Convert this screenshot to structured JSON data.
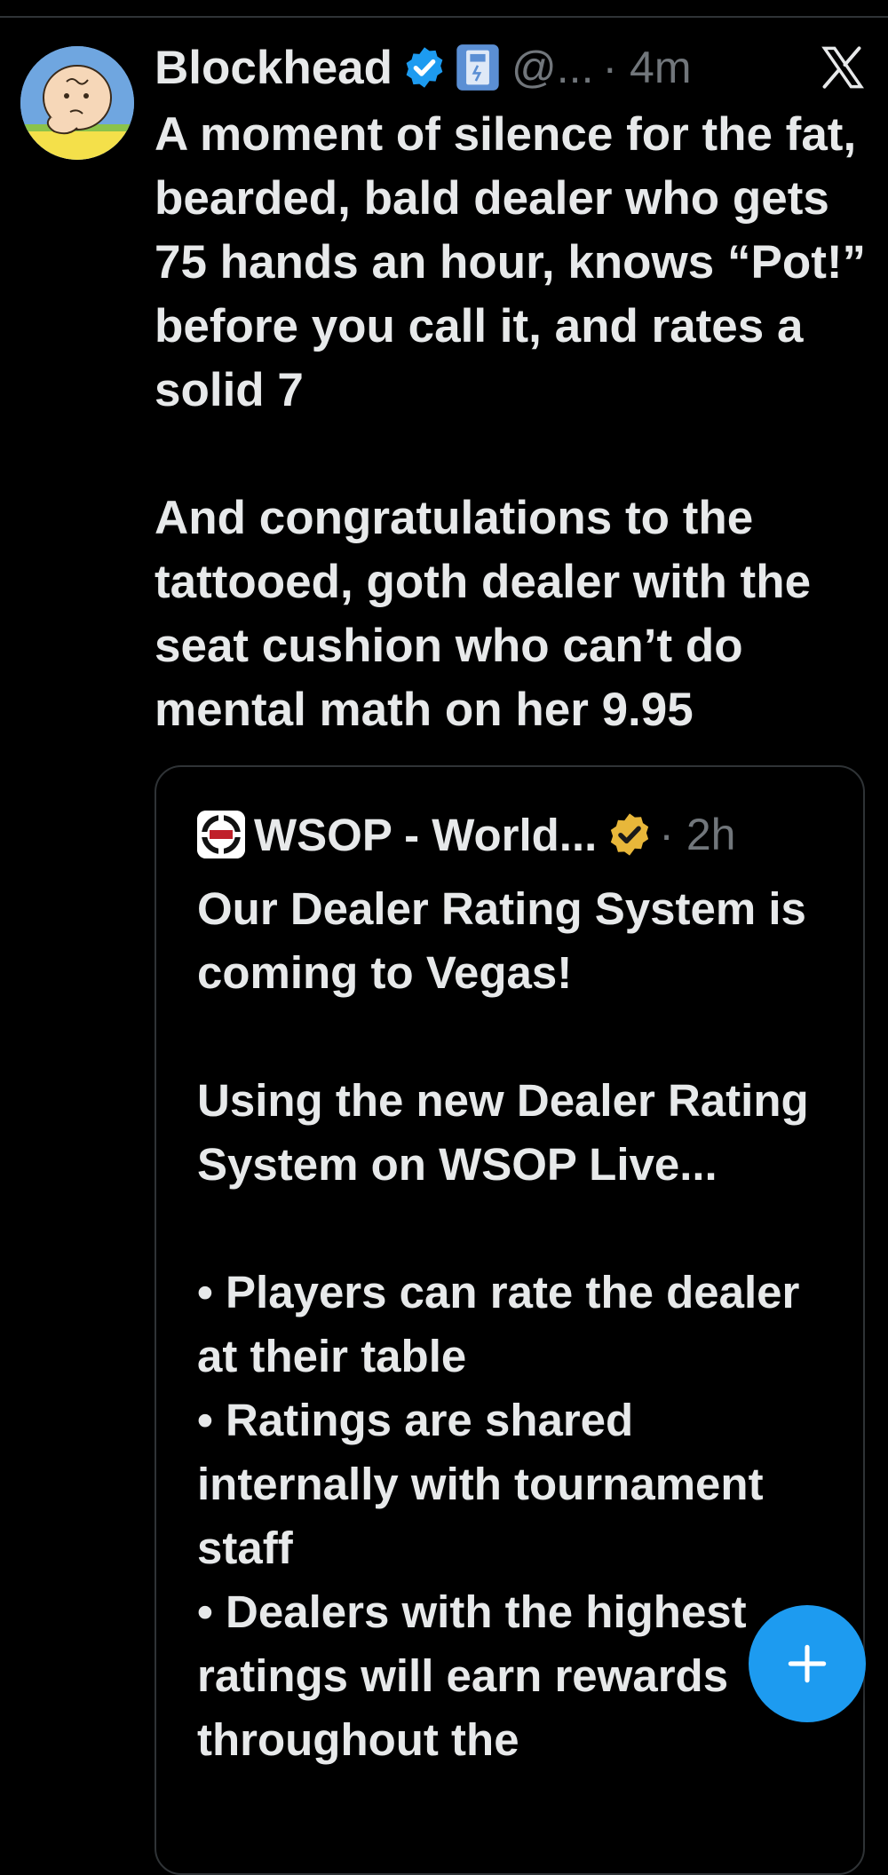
{
  "tweet": {
    "author_name": "Blockhead",
    "handle": "@...",
    "time": "· 4m",
    "paragraphs": [
      "A moment of silence for the fat, bearded, bald dealer who gets 75 hands an hour, knows “Pot!” before you call it, and rates a solid 7",
      "And congratulations to the tattooed, goth dealer with the seat cushion who can’t do mental math on her 9.95"
    ]
  },
  "quote": {
    "author_name": "WSOP - World...",
    "time": "· 2h",
    "lines": [
      "Our Dealer Rating System is coming to Vegas!",
      "Using the new Dealer Rating System on WSOP Live...",
      "• Players can rate the dealer at their table",
      "• Ratings are shared internally with tournament staff",
      "• Dealers with the highest ratings will earn rewards throughout the"
    ]
  },
  "icons": {
    "avatar": "avatar-charlie-brown",
    "verified": "verified-badge-icon",
    "affiliate": "affiliate-badge-icon",
    "close": "x-close-icon",
    "quote_logo": "wsop-logo-icon",
    "quote_verified": "gold-verified-badge-icon",
    "compose": "plus-icon"
  },
  "colors": {
    "background": "#000000",
    "text": "#e7e9ea",
    "muted": "#71767b",
    "accent": "#1d9bf0",
    "gold_badge": "#e8b73a"
  }
}
